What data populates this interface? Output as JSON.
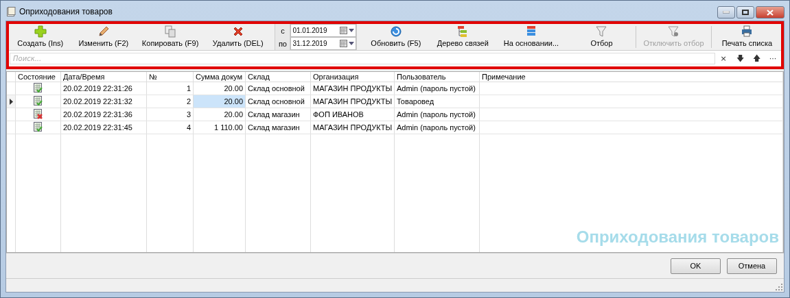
{
  "window": {
    "title": "Оприходования товаров"
  },
  "toolbar": {
    "buttons": [
      {
        "label": "Создать (Ins)",
        "disabled": false
      },
      {
        "label": "Изменить (F2)",
        "disabled": false
      },
      {
        "label": "Копировать (F9)",
        "disabled": false
      },
      {
        "label": "Удалить (DEL)",
        "disabled": false
      },
      {
        "kind": "dates",
        "from_label": "с",
        "from": "01.01.2019",
        "to_label": "по",
        "to": "31.12.2019"
      },
      {
        "label": "Обновить (F5)",
        "disabled": false
      },
      {
        "label": "Дерево связей",
        "disabled": false
      },
      {
        "label": "На основании...",
        "disabled": false
      },
      {
        "label": "Отбор",
        "disabled": false
      },
      {
        "label": "Отключить отбор",
        "disabled": true
      },
      {
        "label": "Печать списка",
        "disabled": false
      }
    ]
  },
  "search": {
    "placeholder": "Поиск...",
    "buttons": [
      "×",
      "🡇",
      "🡅",
      "···"
    ]
  },
  "table": {
    "columns": [
      "Состояние",
      "Дата/Время",
      "№",
      "Сумма докум",
      "Склад",
      "Организация",
      "Пользователь",
      "Примечание"
    ],
    "rows": [
      {
        "kind": "ok",
        "selected": false,
        "cells": [
          "",
          "20.02.2019 22:31:26",
          "1",
          "20.00",
          "Склад основной",
          "МАГАЗИН ПРОДУКТЫ",
          "Admin (пароль пустой)",
          ""
        ]
      },
      {
        "kind": "ok",
        "selected": true,
        "cells": [
          "",
          "20.02.2019 22:31:32",
          "2",
          "20.00",
          "Склад основной",
          "МАГАЗИН ПРОДУКТЫ",
          "Товаровед",
          ""
        ]
      },
      {
        "kind": "error",
        "selected": false,
        "cells": [
          "",
          "20.02.2019 22:31:36",
          "3",
          "20.00",
          "Склад магазин",
          "ФОП ИВАНОВ",
          "Admin (пароль пустой)",
          ""
        ]
      },
      {
        "kind": "ok",
        "selected": false,
        "cells": [
          "",
          "20.02.2019 22:31:45",
          "4",
          "1 110.00",
          "Склад магазин",
          "МАГАЗИН ПРОДУКТЫ",
          "Admin (пароль пустой)",
          ""
        ]
      }
    ]
  },
  "caption": "Оприходования товаров",
  "buttons": [
    "OK",
    "Отмена"
  ]
}
